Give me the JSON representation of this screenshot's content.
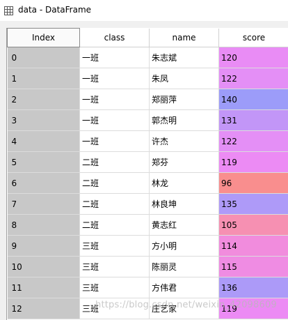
{
  "window": {
    "title": "data - DataFrame",
    "icon": "table-grid-icon"
  },
  "table": {
    "columns": [
      "Index",
      "class",
      "name",
      "score"
    ],
    "rows": [
      {
        "index": "0",
        "class": "一班",
        "name": "朱志斌",
        "score": "120",
        "color": "#e98cf5"
      },
      {
        "index": "1",
        "class": "一班",
        "name": "朱凤",
        "score": "122",
        "color": "#e48ff6"
      },
      {
        "index": "2",
        "class": "一班",
        "name": "郑丽萍",
        "score": "140",
        "color": "#9c9cf9"
      },
      {
        "index": "3",
        "class": "一班",
        "name": "郭杰明",
        "score": "131",
        "color": "#c296f7"
      },
      {
        "index": "4",
        "class": "一班",
        "name": "许杰",
        "score": "122",
        "color": "#e48ff6"
      },
      {
        "index": "5",
        "class": "二班",
        "name": "郑芬",
        "score": "119",
        "color": "#ec8bf4"
      },
      {
        "index": "6",
        "class": "二班",
        "name": "林龙",
        "score": "96",
        "color": "#f98e8e"
      },
      {
        "index": "7",
        "class": "二班",
        "name": "林良坤",
        "score": "135",
        "color": "#ae9af8"
      },
      {
        "index": "8",
        "class": "二班",
        "name": "黄志红",
        "score": "105",
        "color": "#f690b2"
      },
      {
        "index": "9",
        "class": "三班",
        "name": "方小明",
        "score": "114",
        "color": "#f18cdd"
      },
      {
        "index": "10",
        "class": "三班",
        "name": "陈丽灵",
        "score": "115",
        "color": "#ef8ce3"
      },
      {
        "index": "11",
        "class": "三班",
        "name": "方伟君",
        "score": "136",
        "color": "#ac9af8"
      },
      {
        "index": "12",
        "class": "三班",
        "name": "庄艺家",
        "score": "119",
        "color": "#ec8bf4"
      }
    ]
  },
  "watermark": "https://blog.csdn.net/weixin_42098609"
}
